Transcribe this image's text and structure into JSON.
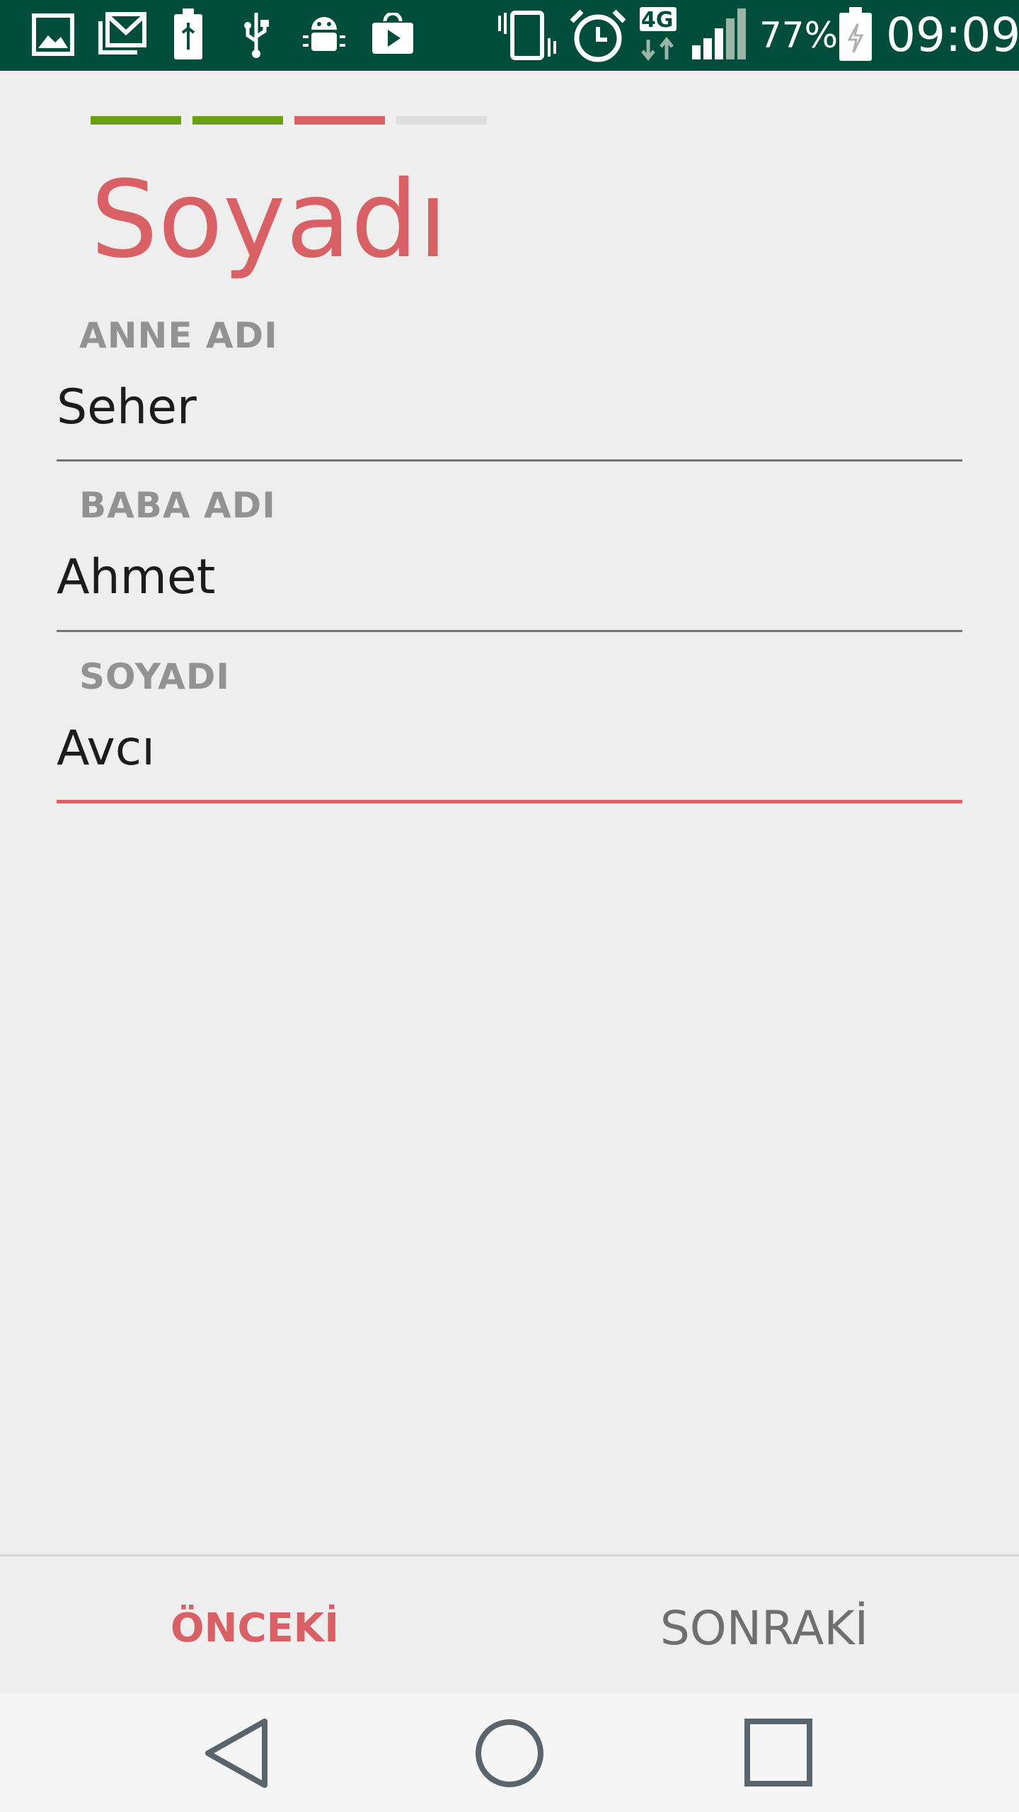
{
  "status_bar": {
    "battery_percent": "77%",
    "time": "09:09",
    "network_type": "4G",
    "icons": [
      "gallery-icon",
      "gmail-icon",
      "usb-battery-icon",
      "usb-icon",
      "android-debug-icon",
      "play-store-icon",
      "vibrate-icon",
      "alarm-icon",
      "network-4g-icon",
      "signal-icon",
      "battery-icon"
    ],
    "background_color": "#014d3b"
  },
  "progress": {
    "steps": [
      {
        "state": "done",
        "color": "#6e9e16"
      },
      {
        "state": "done",
        "color": "#6e9e16"
      },
      {
        "state": "current",
        "color": "#d96064"
      },
      {
        "state": "todo",
        "color": "#dedede"
      }
    ]
  },
  "page": {
    "title": "Soyadı",
    "accent_color": "#d96064"
  },
  "form": {
    "fields": [
      {
        "label": "ANNE ADI",
        "value": "Seher"
      },
      {
        "label": "BABA ADI",
        "value": "Ahmet"
      },
      {
        "label": "SOYADI",
        "value": "Avcı"
      }
    ]
  },
  "footer": {
    "prev_label": "ÖNCEKİ",
    "next_label": "SONRAKİ"
  },
  "nav_bar": {
    "icons": [
      "back-icon",
      "home-icon",
      "recents-icon"
    ]
  }
}
